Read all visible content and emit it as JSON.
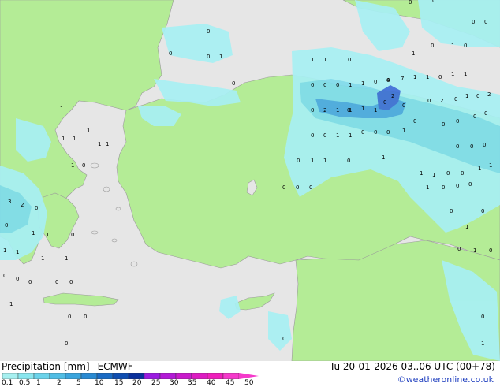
{
  "legend": {
    "title": "Precipitation [mm]",
    "model": "ECMWF",
    "scale_labels": [
      "0.1",
      "0.5",
      "1",
      "2",
      "5",
      "10",
      "15",
      "20",
      "25",
      "30",
      "35",
      "40",
      "45",
      "50"
    ],
    "scale_colors": [
      "#a7f0f0",
      "#8ae6ee",
      "#6bd3ea",
      "#51bde4",
      "#3aa4dc",
      "#2a8ad2",
      "#1a6bc4",
      "#0f4eb1",
      "#0a2f9b",
      "#9a1ce0",
      "#b31ad6",
      "#c81acb",
      "#dd1bc2",
      "#ee1fbb",
      "#f53acb"
    ]
  },
  "timestamp": "Tu 20-01-2026 03..06 UTC (00+78)",
  "credit": "©weatheronline.co.uk",
  "colors": {
    "sea": "#e6e6e6",
    "land": "#b4ec96",
    "precip_light": "#a8f0f4",
    "precip_mid": "#7fdcec",
    "precip_heavy": "#4aa8e2",
    "precip_peak": "#3c6fd8"
  },
  "grid_values": [
    {
      "v": "0"
    },
    {
      "v": "0"
    },
    {
      "v": "0"
    },
    {
      "v": "1"
    },
    {
      "v": "1"
    },
    {
      "v": "1"
    },
    {
      "v": "1"
    },
    {
      "v": "0"
    },
    {
      "v": "1"
    },
    {
      "v": "0"
    },
    {
      "v": "1"
    },
    {
      "v": "0"
    },
    {
      "v": "0"
    },
    {
      "v": "0"
    },
    {
      "v": "0"
    },
    {
      "v": "0"
    },
    {
      "v": "0"
    },
    {
      "v": "0"
    },
    {
      "v": "0"
    },
    {
      "v": "0"
    },
    {
      "v": "1"
    },
    {
      "v": "1"
    },
    {
      "v": "0"
    },
    {
      "v": "0"
    },
    {
      "v": "2"
    },
    {
      "v": "0"
    },
    {
      "v": "1"
    },
    {
      "v": "0"
    },
    {
      "v": "1"
    },
    {
      "v": "4"
    },
    {
      "v": "7"
    },
    {
      "v": "1"
    },
    {
      "v": "1"
    },
    {
      "v": "0"
    },
    {
      "v": "1"
    },
    {
      "v": "1"
    },
    {
      "v": "2"
    },
    {
      "v": "0"
    },
    {
      "v": "0"
    },
    {
      "v": "1"
    },
    {
      "v": "0"
    },
    {
      "v": "2"
    },
    {
      "v": "0"
    },
    {
      "v": "2"
    },
    {
      "v": "1"
    },
    {
      "v": "1"
    },
    {
      "v": "1"
    },
    {
      "v": "0"
    },
    {
      "v": "0"
    },
    {
      "v": "0"
    },
    {
      "v": "1"
    },
    {
      "v": "1"
    },
    {
      "v": "0"
    },
    {
      "v": "0"
    },
    {
      "v": "0"
    },
    {
      "v": "1"
    },
    {
      "v": "0"
    },
    {
      "v": "0"
    },
    {
      "v": "0"
    },
    {
      "v": "0"
    },
    {
      "v": "0"
    },
    {
      "v": "0"
    },
    {
      "v": "0"
    },
    {
      "v": "0"
    },
    {
      "v": "0"
    },
    {
      "v": "1"
    },
    {
      "v": "1"
    },
    {
      "v": "0"
    },
    {
      "v": "1"
    },
    {
      "v": "1"
    },
    {
      "v": "1"
    },
    {
      "v": "0"
    },
    {
      "v": "0"
    },
    {
      "v": "1"
    },
    {
      "v": "1"
    },
    {
      "v": "1"
    },
    {
      "v": "0"
    },
    {
      "v": "0"
    },
    {
      "v": "0"
    },
    {
      "v": "0"
    },
    {
      "v": "3"
    },
    {
      "v": "2"
    },
    {
      "v": "0"
    },
    {
      "v": "0"
    },
    {
      "v": "1"
    },
    {
      "v": "1"
    },
    {
      "v": "0"
    },
    {
      "v": "1"
    },
    {
      "v": "1"
    },
    {
      "v": "1"
    },
    {
      "v": "1"
    },
    {
      "v": "0"
    },
    {
      "v": "0"
    },
    {
      "v": "0"
    },
    {
      "v": "0"
    },
    {
      "v": "0"
    },
    {
      "v": "1"
    },
    {
      "v": "0"
    },
    {
      "v": "0"
    },
    {
      "v": "0"
    },
    {
      "v": "0"
    },
    {
      "v": "0"
    },
    {
      "v": "0"
    },
    {
      "v": "0"
    },
    {
      "v": "1"
    },
    {
      "v": "1"
    },
    {
      "v": "1"
    },
    {
      "v": "0"
    },
    {
      "v": "0"
    },
    {
      "v": "0"
    },
    {
      "v": "1"
    },
    {
      "v": "0"
    },
    {
      "v": "1"
    },
    {
      "v": "1"
    },
    {
      "v": "1"
    },
    {
      "v": "1"
    },
    {
      "v": "1"
    },
    {
      "v": "0"
    },
    {
      "v": "1"
    },
    {
      "v": "1"
    },
    {
      "v": "1"
    },
    {
      "v": "1"
    },
    {
      "v": "0"
    },
    {
      "v": "0"
    },
    {
      "v": "0"
    },
    {
      "v": "1"
    },
    {
      "v": "1"
    },
    {
      "v": "1"
    }
  ]
}
